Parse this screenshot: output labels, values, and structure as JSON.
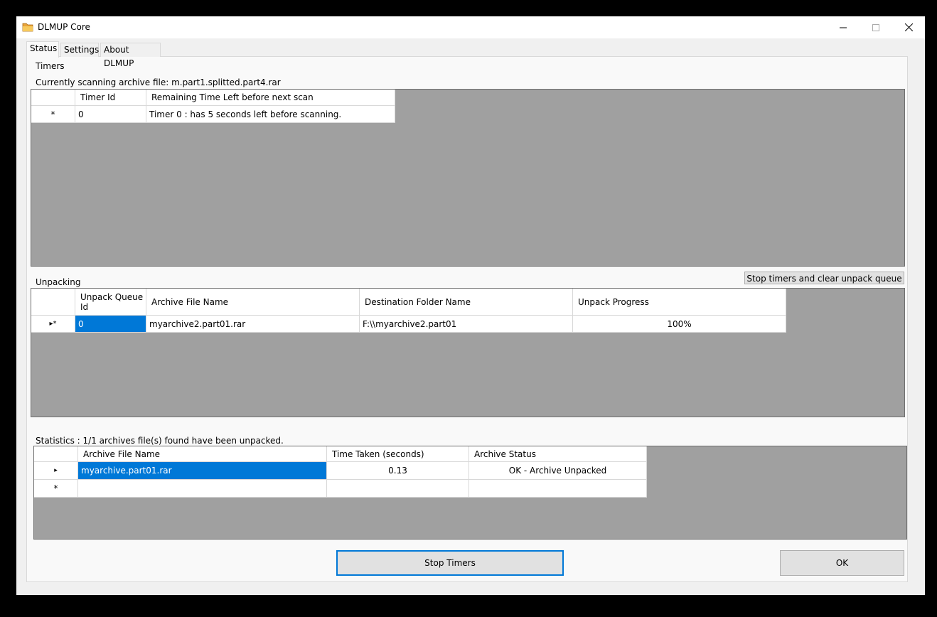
{
  "window": {
    "title": "DLMUP Core",
    "accent": "#0078d7"
  },
  "tabs": [
    "Status",
    "Settings",
    "About DLMUP"
  ],
  "timers": {
    "group_label": "Timers",
    "scanning_label": "Currently scanning archive file: m.part1.splitted.part4.rar",
    "columns": [
      "Timer Id",
      "Remaining Time Left before next scan"
    ],
    "rows": [
      {
        "marker": "*",
        "id": "0",
        "remaining": "Timer 0 : has 5 seconds left before scanning."
      }
    ]
  },
  "unpacking": {
    "group_label": "Unpacking",
    "clear_button": "Stop timers and clear unpack queue",
    "columns": [
      "Unpack Queue Id",
      "Archive File Name",
      "Destination Folder Name",
      "Unpack Progress"
    ],
    "rows": [
      {
        "marker": "▸*",
        "queue_id": "0",
        "file": "myarchive2.part01.rar",
        "dest": "F:\\\\myarchive2.part01",
        "progress": "100%"
      }
    ]
  },
  "statistics": {
    "label": "Statistics : 1/1 archives file(s) found have been unpacked.",
    "columns": [
      "Archive File Name",
      "Time Taken (seconds)",
      "Archive Status"
    ],
    "rows": [
      {
        "marker": "▸",
        "file": "myarchive.part01.rar",
        "time": "0.13",
        "status": "OK - Archive Unpacked"
      },
      {
        "marker": "*",
        "file": "",
        "time": "",
        "status": ""
      }
    ]
  },
  "buttons": {
    "stop_timers": "Stop Timers",
    "ok": "OK"
  }
}
